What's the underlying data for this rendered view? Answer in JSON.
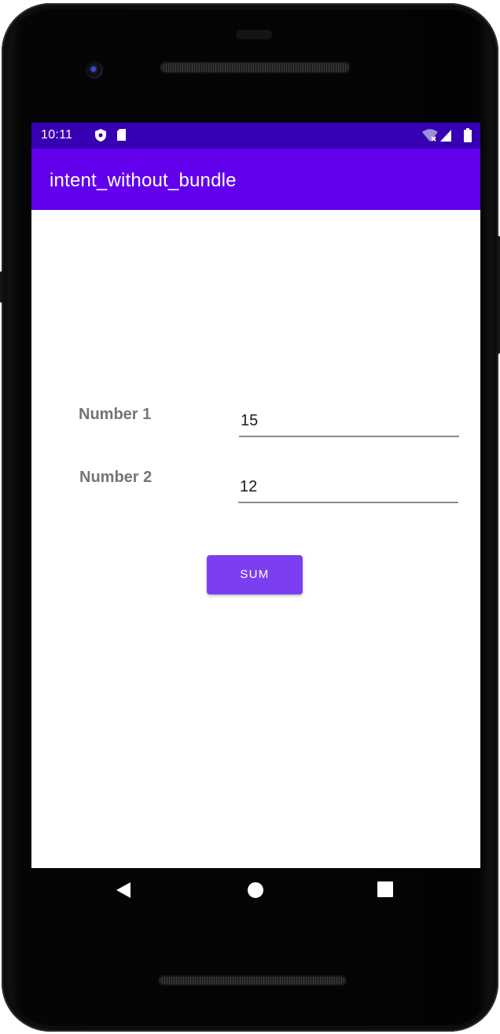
{
  "status_bar": {
    "time": "10:11",
    "left_icons": [
      "shield-icon",
      "sd-card-icon"
    ],
    "right_icons": [
      "wifi-icon",
      "cell-signal-icon",
      "battery-icon"
    ]
  },
  "app_bar": {
    "title": "intent_without_bundle"
  },
  "form": {
    "number1_label": "Number 1",
    "number1_value": "15",
    "number2_label": "Number 2",
    "number2_value": "12",
    "sum_button_label": "SUM"
  },
  "nav_bar": {
    "items": [
      "back-icon",
      "home-icon",
      "recents-icon"
    ]
  },
  "colors": {
    "status_bar": "#3800b3",
    "app_bar": "#6200ee",
    "button": "#7c3ff0",
    "label": "#757575"
  }
}
